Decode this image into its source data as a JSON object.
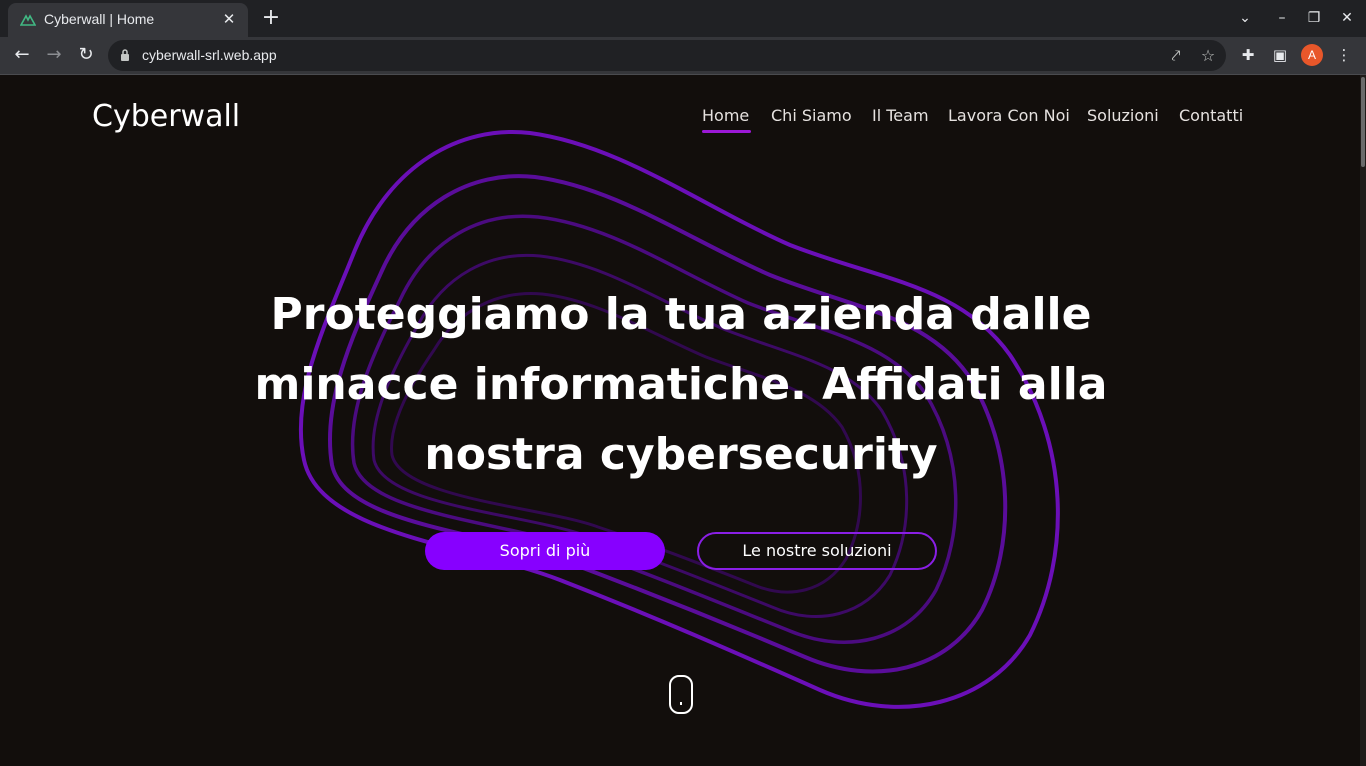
{
  "browser": {
    "tab_title": "Cyberwall | Home",
    "url": "cyberwall-srl.web.app",
    "avatar_letter": "A",
    "icons": [
      "vue-favicon-icon",
      "close-icon",
      "plus-icon",
      "chevron-down-icon",
      "minimize-icon",
      "restore-icon",
      "close-window-icon",
      "back-icon",
      "forward-icon",
      "reload-icon",
      "lock-icon",
      "share-icon",
      "star-icon",
      "extensions-icon",
      "side-panel-icon",
      "menu-icon"
    ]
  },
  "site": {
    "logo": "Cyberwall",
    "nav": [
      "Home",
      "Chi Siamo",
      "Il Team",
      "Lavora Con Noi",
      "Soluzioni",
      "Contatti"
    ],
    "active_nav": "Home",
    "hero_title": "Proteggiamo la tua azienda dalle minacce informatiche. Affidati alla nostra cybersecurity",
    "primary_button": "Sopri di più",
    "secondary_button": "Le nostre soluzioni",
    "colors": {
      "background": "#120e0c",
      "accent": "#8700ff",
      "nav_underline": "#9b18d6",
      "blob_stroke": "#7a0fc2"
    }
  }
}
